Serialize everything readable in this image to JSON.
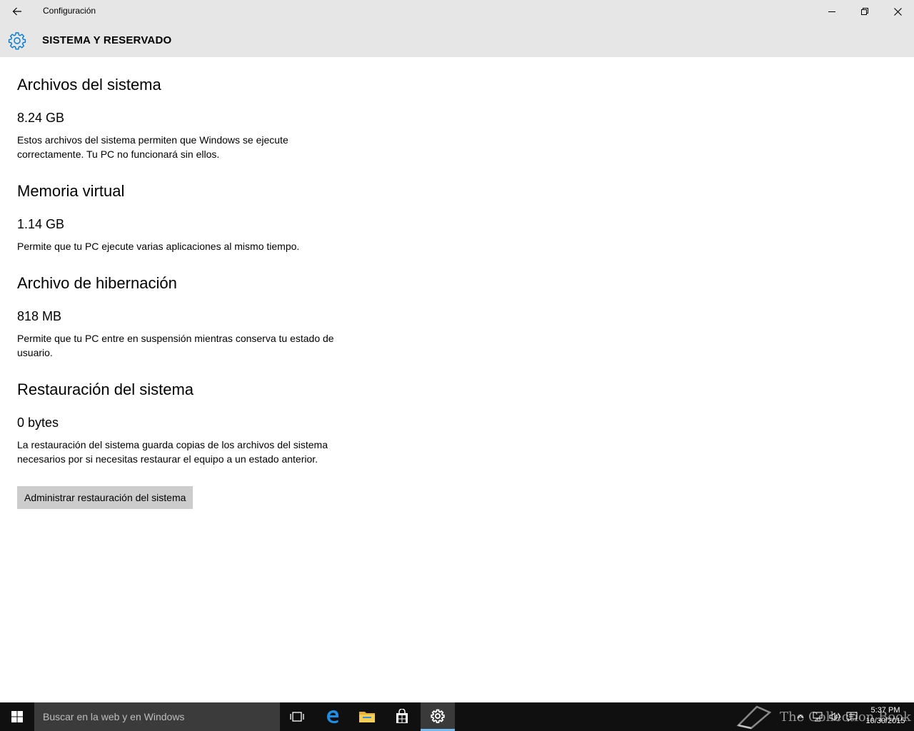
{
  "window": {
    "title": "Configuración",
    "back_icon": "arrow-left-icon",
    "minimize_icon": "minimize-icon",
    "maximize_icon": "restore-icon",
    "close_icon": "close-icon"
  },
  "header": {
    "icon": "gear-icon",
    "title": "SISTEMA Y RESERVADO",
    "accent": "#0078d7"
  },
  "sections": [
    {
      "title": "Archivos del sistema",
      "size": "8.24 GB",
      "description": "Estos archivos del sistema permiten que Windows se ejecute correctamente. Tu PC no funcionará sin ellos."
    },
    {
      "title": "Memoria virtual",
      "size": "1.14 GB",
      "description": "Permite que tu PC ejecute varias aplicaciones al mismo tiempo."
    },
    {
      "title": "Archivo de hibernación",
      "size": "818 MB",
      "description": "Permite que tu PC entre en suspensión mientras conserva tu estado de usuario."
    },
    {
      "title": "Restauración del sistema",
      "size": "0 bytes",
      "description": "La restauración del sistema guarda copias de los archivos del sistema necesarios por si necesitas restaurar el equipo a un estado anterior."
    }
  ],
  "button": {
    "label": "Administrar restauración del sistema"
  },
  "taskbar": {
    "search_placeholder": "Buscar en la web y en Windows",
    "icons": [
      "windows-start-icon",
      "task-view-icon",
      "edge-icon",
      "file-explorer-icon",
      "store-icon",
      "settings-icon"
    ],
    "tray_icons": [
      "chevron-up-icon",
      "network-icon",
      "volume-icon",
      "action-center-icon"
    ],
    "clock_time": "5:37 PM",
    "clock_date": "10/30/2015",
    "watermark": "The Collection Book",
    "active_accent": "#76b9ed"
  }
}
